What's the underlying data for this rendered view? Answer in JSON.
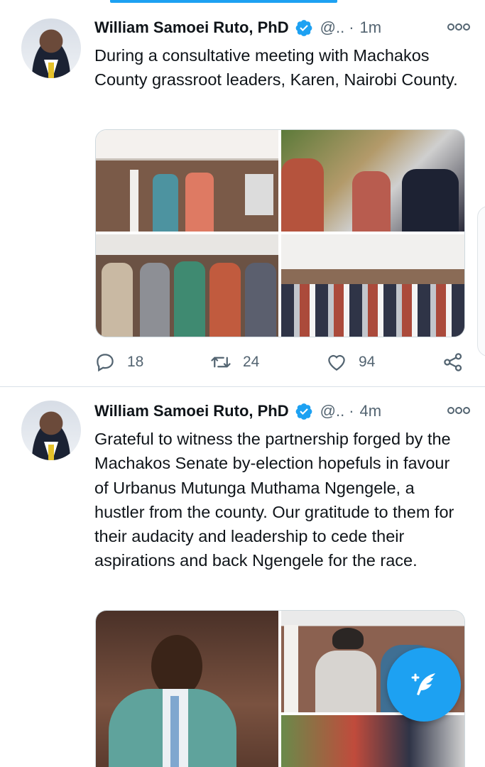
{
  "colors": {
    "accent": "#1da1f2",
    "secondary_text": "#536471",
    "primary_text": "#0f1419"
  },
  "tweets": [
    {
      "author_name": "William Samoei Ruto, PhD",
      "verified": true,
      "handle": "@..",
      "separator": "·",
      "time": "1m",
      "text": "During a consultative meeting with Machakos County grassroot leaders, Karen, Nairobi County.",
      "replies": "18",
      "retweets": "24",
      "likes": "94",
      "icons": [
        "reply-icon",
        "retweet-icon",
        "like-icon",
        "share-icon"
      ]
    },
    {
      "author_name": "William Samoei Ruto, PhD",
      "verified": true,
      "handle": "@..",
      "separator": "·",
      "time": "4m",
      "text": "Grateful to witness the partnership forged by the Machakos Senate by-election hopefuls in favour of Urbanus Mutunga Muthama Ngengele, a hustler from the county. Our gratitude to them for their audacity and leadership to cede their aspirations and back Ngengele for the race."
    }
  ],
  "compose": {
    "icon": "compose-tweet-icon"
  }
}
